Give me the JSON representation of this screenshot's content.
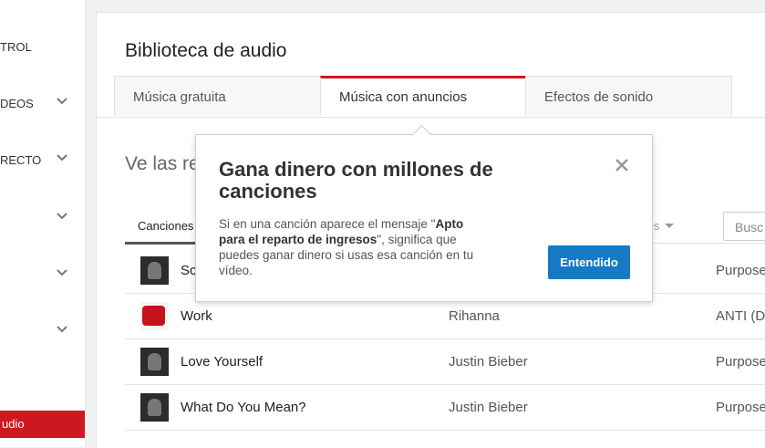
{
  "sidebar": {
    "items": [
      {
        "label": "TROL",
        "chevron": false
      },
      {
        "label": "DEOS",
        "chevron": true
      },
      {
        "label": "RECTO",
        "chevron": true
      },
      {
        "label": "",
        "chevron": true
      },
      {
        "label": "",
        "chevron": true
      },
      {
        "label": "",
        "chevron": true
      }
    ],
    "active_label": "udio"
  },
  "header": {
    "title": "Biblioteca de audio"
  },
  "tabs": [
    {
      "label": "Música gratuita",
      "active": false
    },
    {
      "label": "Música con anuncios",
      "active": true
    },
    {
      "label": "Efectos de sonido",
      "active": false
    }
  ],
  "intro_text": "Ve las re",
  "subtab": {
    "label": "Canciones"
  },
  "filter": {
    "label": "sos"
  },
  "search": {
    "placeholder": "Busc"
  },
  "songs": [
    {
      "title": "Sc",
      "artist": "",
      "album": "Purpose",
      "thumb": "dark"
    },
    {
      "title": "Work",
      "artist": "Rihanna",
      "album": "ANTI (D",
      "thumb": "red"
    },
    {
      "title": "Love Yourself",
      "artist": "Justin Bieber",
      "album": "Purpose",
      "thumb": "dark"
    },
    {
      "title": "What Do You Mean?",
      "artist": "Justin Bieber",
      "album": "Purpose",
      "thumb": "dark"
    }
  ],
  "popup": {
    "title": "Gana dinero con millones de canciones",
    "body_part1": "Si en una canción aparece el mensaje \"",
    "body_bold": "Apto para el reparto de ingresos",
    "body_part2": "\", significa que puedes ganar dinero si usas esa canción en tu vídeo.",
    "button_label": "Entendido"
  },
  "colors": {
    "accent": "#cc181e",
    "button": "#167ac6"
  }
}
